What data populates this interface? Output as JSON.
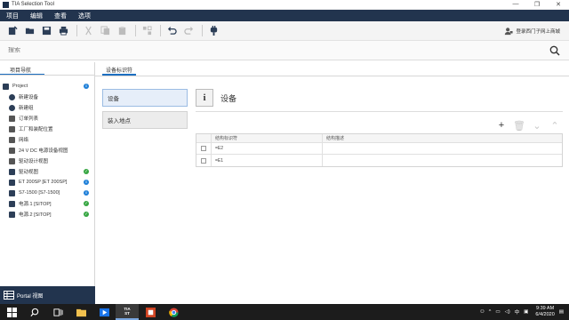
{
  "window": {
    "title": "TIA Selection Tool",
    "minimize": "—",
    "maximize": "❐",
    "close": "✕"
  },
  "menu": [
    "项目",
    "编辑",
    "查看",
    "选项"
  ],
  "toolbar": {
    "register_label": "登录西门子网上商城"
  },
  "search": {
    "placeholder": "搜索"
  },
  "left": {
    "tab": "项目导航",
    "tree": [
      {
        "label": "Project",
        "icon": "project-icon",
        "status": "info"
      },
      {
        "label": "新建设备",
        "icon": "add-device-icon",
        "status": ""
      },
      {
        "label": "新建组",
        "icon": "add-group-icon",
        "status": ""
      },
      {
        "label": "订单列表",
        "icon": "order-list-icon",
        "status": ""
      },
      {
        "label": "工厂和装配位置",
        "icon": "plant-icon",
        "status": ""
      },
      {
        "label": "网络",
        "icon": "network-icon",
        "status": ""
      },
      {
        "label": "24 V DC 电源设备视图",
        "icon": "power-icon",
        "status": ""
      },
      {
        "label": "驱动设计视图",
        "icon": "drive-icon",
        "status": ""
      },
      {
        "label": "驱动视图",
        "icon": "drive-view-icon",
        "status": "ok"
      },
      {
        "label": "ET 200SP [ET 200SP]",
        "icon": "device-icon",
        "status": "info"
      },
      {
        "label": "S7-1500 [S7-1500]",
        "icon": "device-icon",
        "status": "info"
      },
      {
        "label": "电源.1 [SITOP]",
        "icon": "device-icon",
        "status": "ok"
      },
      {
        "label": "电源.2 [SITOP]",
        "icon": "device-icon",
        "status": "ok"
      }
    ],
    "portal": "Portal 视图"
  },
  "main": {
    "tab": "设备标识符",
    "nav_device": "设备",
    "nav_location": "装入地点",
    "header_title": "设备",
    "info_glyph": "i",
    "grid": {
      "col_identifier": "结构标识符",
      "col_description": "结构描述",
      "rows": [
        {
          "identifier": "=E2",
          "description": ""
        },
        {
          "identifier": "=E1",
          "description": ""
        }
      ]
    }
  },
  "taskbar": {
    "tia_label": "TIA ST",
    "ime": "中",
    "time": "9:39 AM",
    "date": "6/4/2020"
  },
  "colors": {
    "menubar": "#22344e",
    "accent": "#1d6fc1",
    "ok": "#36a642",
    "info": "#1e7fd8"
  }
}
